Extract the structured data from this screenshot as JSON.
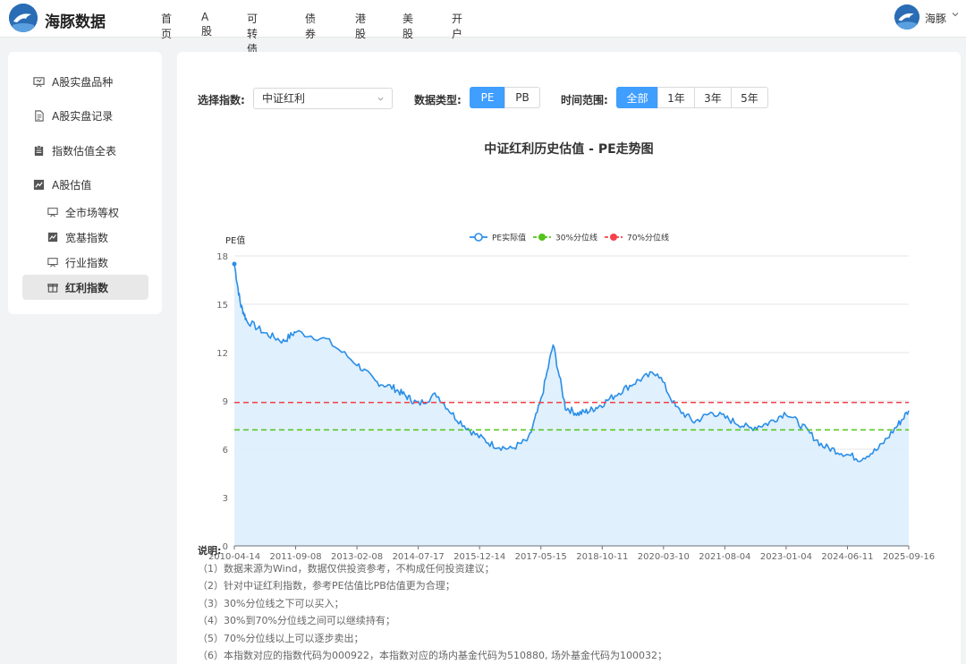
{
  "header": {
    "brand": "海豚数据",
    "nav": [
      "首页",
      "A股",
      "可转债",
      "债券",
      "港股",
      "美股",
      "开户"
    ],
    "user": "海豚"
  },
  "sidebar": {
    "items": [
      {
        "label": "A股实盘品种",
        "icon": "presentation-icon"
      },
      {
        "label": "A股实盘记录",
        "icon": "document-icon"
      },
      {
        "label": "指数估值全表",
        "icon": "clipboard-icon"
      },
      {
        "label": "A股估值",
        "icon": "chart-icon"
      }
    ],
    "sub_items": [
      {
        "label": "全市场等权",
        "icon": "presentation-icon"
      },
      {
        "label": "宽基指数",
        "icon": "chart-icon"
      },
      {
        "label": "行业指数",
        "icon": "presentation-icon"
      },
      {
        "label": "红利指数",
        "icon": "gift-icon",
        "active": true
      }
    ]
  },
  "controls": {
    "index_label": "选择指数:",
    "index_value": "中证红利",
    "type_label": "数据类型:",
    "types": [
      "PE",
      "PB"
    ],
    "type_selected": "PE",
    "range_label": "时间范围:",
    "ranges": [
      "全部",
      "1年",
      "3年",
      "5年"
    ],
    "range_selected": "全部"
  },
  "chart_data": {
    "type": "line",
    "title": "中证红利历史估值 - PE走势图",
    "ylabel": "PE值",
    "ylim": [
      0,
      18
    ],
    "yticks": [
      0,
      3,
      6,
      9,
      12,
      15,
      18
    ],
    "xticks": [
      "2010-04-14",
      "2011-09-08",
      "2013-02-08",
      "2014-07-17",
      "2015-12-14",
      "2017-05-15",
      "2018-10-11",
      "2020-03-10",
      "2021-08-04",
      "2023-01-04",
      "2024-06-11",
      "2025-09-16"
    ],
    "legend": [
      "PE实际值",
      "30%分位线",
      "70%分位线"
    ],
    "legend_position": "top-center",
    "colors": {
      "pe": "#2a8ee8",
      "p30": "#52c41a",
      "p70": "#f5414b",
      "area": "#ddeefc"
    },
    "p30": 7.2,
    "p70": 8.9,
    "series": [
      {
        "name": "PE实际值",
        "x": [
          0,
          0.1,
          0.2,
          0.5,
          0.8,
          1.0,
          1.5,
          2.0,
          2.3,
          2.6,
          2.8,
          3.0,
          3.3,
          3.6,
          3.9,
          4.2,
          4.5,
          4.8,
          5.0,
          5.2,
          5.4,
          5.6,
          5.8,
          6.0,
          6.3,
          6.6,
          6.9,
          7.2,
          7.5,
          7.8,
          8.1,
          8.4,
          8.7,
          9.0,
          9.3,
          9.6,
          9.9,
          10.2,
          10.5,
          10.8,
          11.0
        ],
        "values": [
          17.5,
          15.0,
          14.0,
          13.2,
          12.7,
          13.3,
          12.8,
          11.3,
          10.2,
          9.8,
          9.3,
          8.8,
          9.4,
          8.0,
          7.0,
          6.3,
          6.0,
          6.6,
          9.0,
          12.5,
          8.6,
          8.2,
          8.4,
          8.8,
          9.6,
          10.3,
          10.8,
          8.6,
          7.7,
          8.3,
          7.8,
          7.3,
          7.6,
          8.3,
          7.3,
          6.2,
          5.8,
          5.4,
          6.0,
          7.4,
          8.4
        ]
      }
    ]
  },
  "notes": {
    "title": "说明:",
    "lines": [
      "（1）数据来源为Wind，数据仅供投资参考，不构成任何投资建议；",
      "（2）针对中证红利指数，参考PE估值比PB估值更为合理；",
      "（3）30%分位线之下可以买入；",
      "（4）30%到70%分位线之间可以继续持有；",
      "（5）70%分位线以上可以逐步卖出；",
      "（6）本指数对应的指数代码为000922，本指数对应的场内基金代码为510880, 场外基金代码为100032；"
    ]
  }
}
